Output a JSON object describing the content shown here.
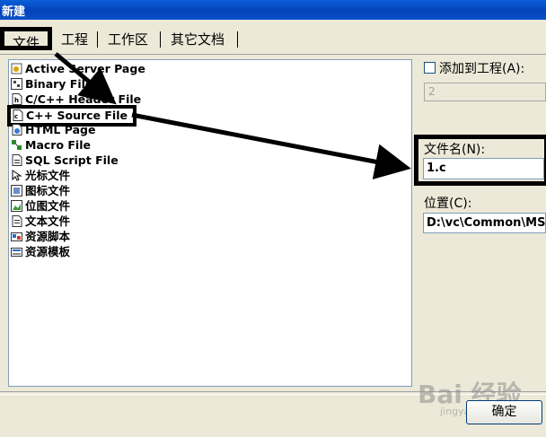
{
  "window": {
    "title": "新建"
  },
  "tabs": [
    {
      "label": "文件",
      "active": true
    },
    {
      "label": "工程"
    },
    {
      "label": "工作区"
    },
    {
      "label": "其它文档"
    }
  ],
  "file_types": [
    {
      "label": "Active Server Page",
      "icon": "asp-icon"
    },
    {
      "label": "Binary File",
      "icon": "binary-icon"
    },
    {
      "label": "C/C++ Header File",
      "icon": "header-icon"
    },
    {
      "label": "C++ Source File",
      "icon": "cpp-icon",
      "selected": true
    },
    {
      "label": "HTML Page",
      "icon": "html-icon"
    },
    {
      "label": "Macro File",
      "icon": "macro-icon"
    },
    {
      "label": "SQL Script File",
      "icon": "sql-icon"
    },
    {
      "label": "光标文件",
      "icon": "cursor-icon"
    },
    {
      "label": "图标文件",
      "icon": "icon-file-icon"
    },
    {
      "label": "位图文件",
      "icon": "bitmap-icon"
    },
    {
      "label": "文本文件",
      "icon": "text-icon"
    },
    {
      "label": "资源脚本",
      "icon": "resource-script-icon"
    },
    {
      "label": "资源模板",
      "icon": "resource-template-icon"
    }
  ],
  "add_to_project": {
    "label": "添加到工程(A):",
    "checked": false,
    "project_value": "2"
  },
  "filename": {
    "label": "文件名(N):",
    "value": "1.c"
  },
  "location": {
    "label": "位置(C):",
    "value": "D:\\vc\\Common\\MSDe"
  },
  "buttons": {
    "ok": "确定"
  },
  "watermark": {
    "text": "Bai 经验",
    "sub": "jingyan.baidu.com"
  },
  "colors": {
    "titlebar": "#0541b8",
    "dialog_bg": "#ece9d8",
    "highlight": "#000000"
  }
}
